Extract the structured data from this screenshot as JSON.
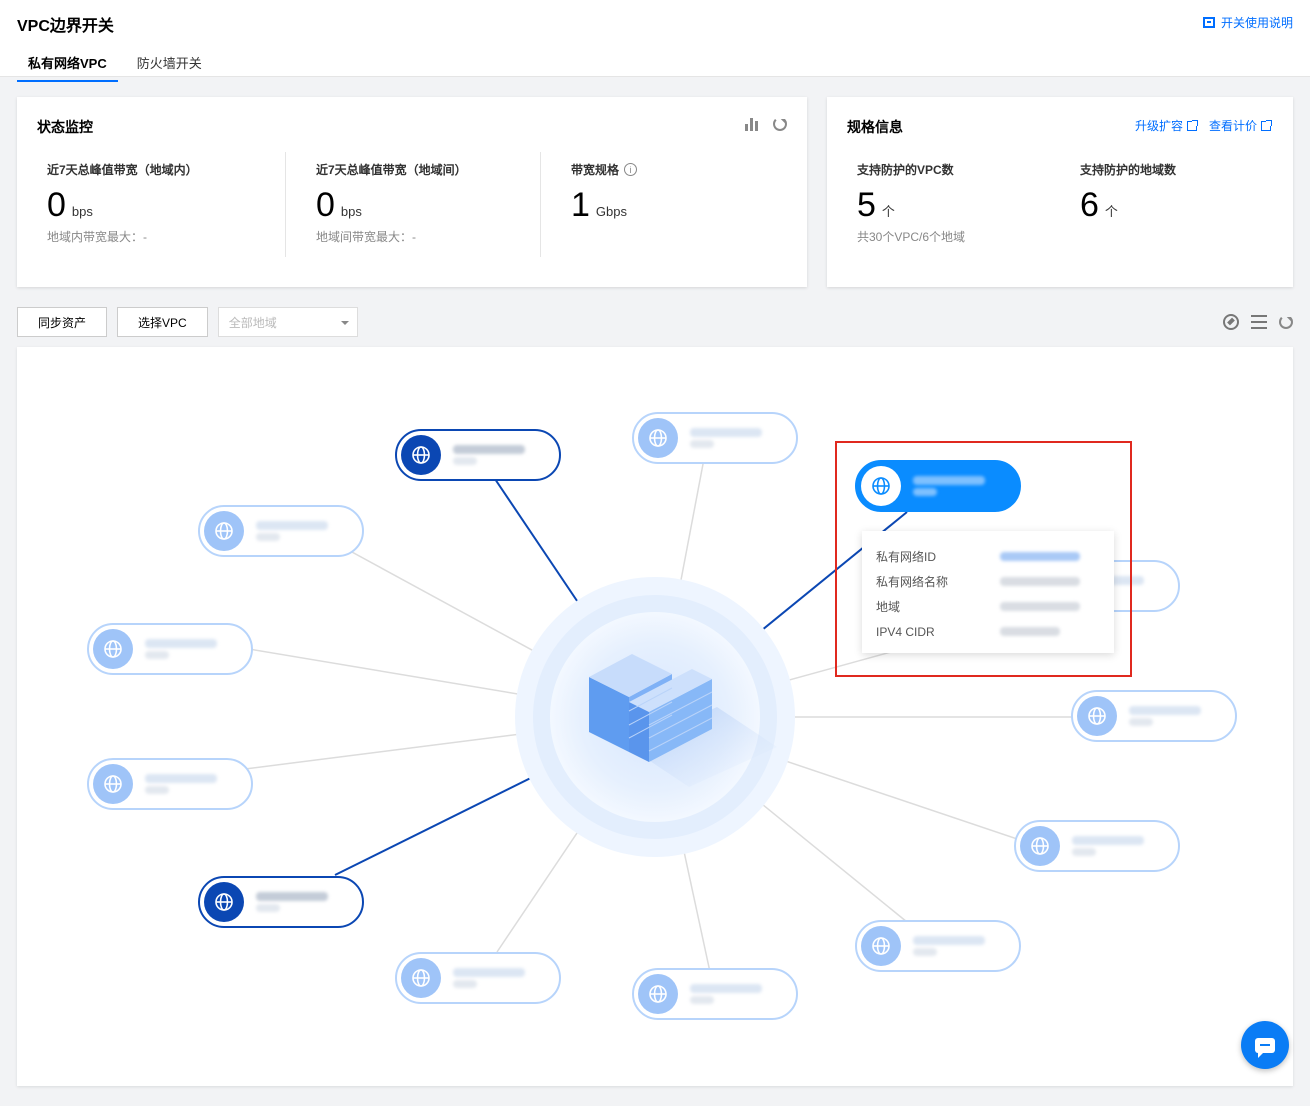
{
  "header": {
    "title": "VPC边界开关",
    "help_link": "开关使用说明",
    "tabs": [
      {
        "label": "私有网络VPC",
        "active": true
      },
      {
        "label": "防火墙开关",
        "active": false
      }
    ]
  },
  "status_monitor": {
    "title": "状态监控",
    "metrics": [
      {
        "label": "近7天总峰值带宽（地域内）",
        "value": "0",
        "unit": "bps",
        "sub": "地域内带宽最大：-"
      },
      {
        "label": "近7天总峰值带宽（地域间）",
        "value": "0",
        "unit": "bps",
        "sub": "地域间带宽最大：-"
      },
      {
        "label": "带宽规格",
        "value": "1",
        "unit": "Gbps",
        "sub": ""
      }
    ]
  },
  "spec_info": {
    "title": "规格信息",
    "upgrade_link": "升级扩容",
    "pricing_link": "查看计价",
    "metrics": [
      {
        "label": "支持防护的VPC数",
        "value": "5",
        "unit": "个",
        "sub": "共30个VPC/6个地域"
      },
      {
        "label": "支持防护的地域数",
        "value": "6",
        "unit": "个",
        "sub": ""
      }
    ]
  },
  "toolbar": {
    "sync_button": "同步资产",
    "select_vpc_button": "选择VPC",
    "region_select_placeholder": "全部地域"
  },
  "tooltip": {
    "rows": [
      {
        "key": "私有网络ID"
      },
      {
        "key": "私有网络名称"
      },
      {
        "key": "地域"
      },
      {
        "key": "IPV4 CIDR"
      }
    ]
  },
  "colors": {
    "accent": "#006eff",
    "node_dark": "#0b47b3",
    "node_light": "#9fc4f8",
    "node_selected": "#0a8cff",
    "highlight": "#e0291f"
  }
}
